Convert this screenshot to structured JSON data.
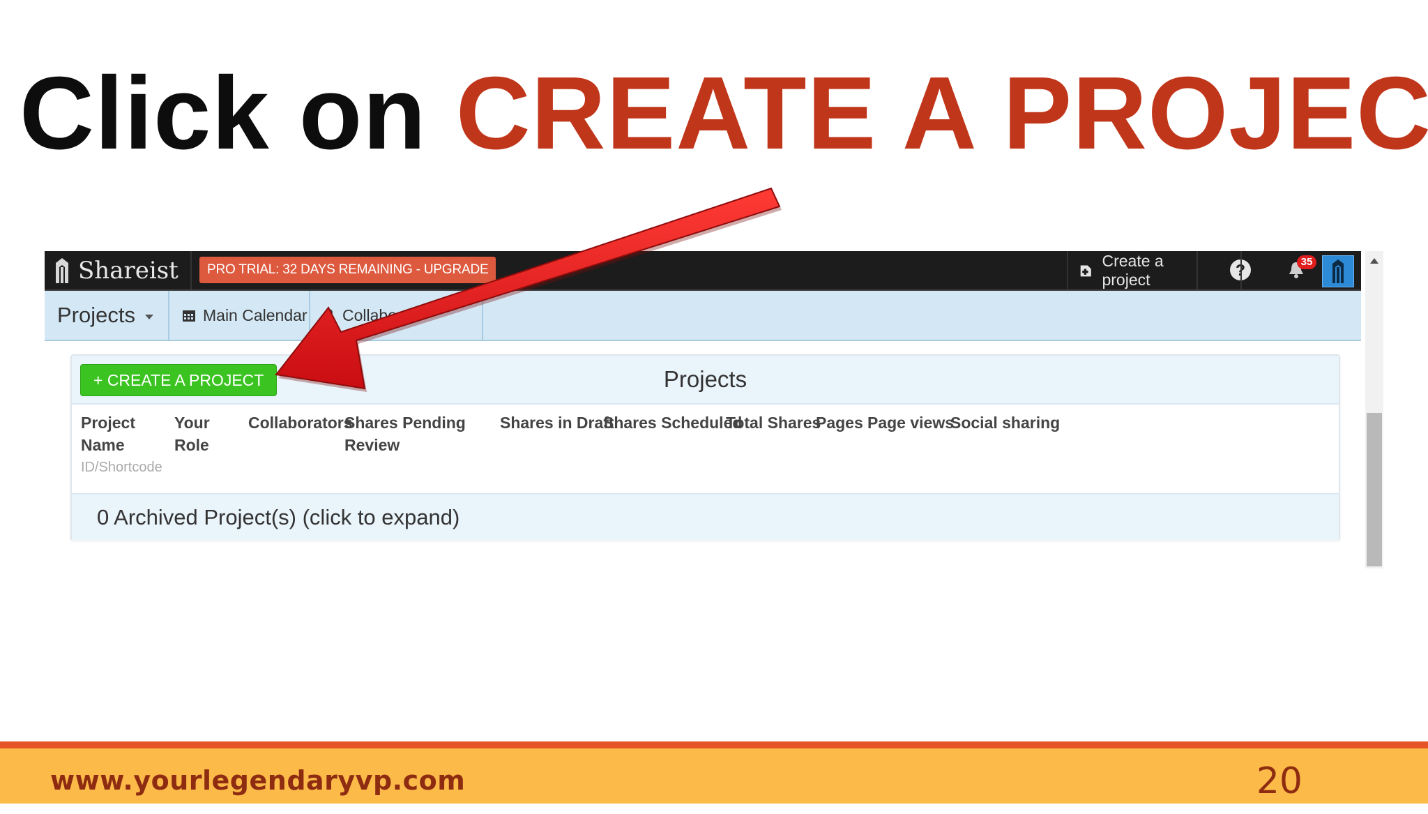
{
  "headline": {
    "prefix": "Click on",
    "highlight": "CREATE A PROJECT"
  },
  "colors": {
    "highlight": "#c0361a",
    "arrow": "#e3141a",
    "green_button": "#3bc321",
    "trial_badge": "#dd5a3f",
    "footer_bar": "#fcbb49",
    "footer_line": "#e55326"
  },
  "app": {
    "logo_text": "Shareist",
    "trial_banner": "PRO TRIAL: 32 DAYS REMAINING - UPGRADE",
    "create_project_label": "Create a project",
    "help_label": "?",
    "notification_count": "35"
  },
  "subnav": {
    "projects_label": "Projects",
    "main_calendar_label": "Main Calendar",
    "collaborators_label": "Collabor"
  },
  "panel": {
    "create_button_label": "+ CREATE A PROJECT",
    "title": "Projects",
    "columns": [
      {
        "line1": "Project",
        "line2": "Name",
        "sub": "ID/Shortcode"
      },
      {
        "line1": "Your",
        "line2": "Role"
      },
      {
        "line1": "Collaborators"
      },
      {
        "line1": "Shares Pending",
        "line2": "Review"
      },
      {
        "line1": "Shares in Draft"
      },
      {
        "line1": "Shares Scheduled"
      },
      {
        "line1": "Total Shares"
      },
      {
        "line1": "Pages"
      },
      {
        "line1": "Page views"
      },
      {
        "line1": "Social sharing"
      }
    ],
    "archived_label": "0 Archived Project(s) (click to expand)"
  },
  "footer": {
    "url": "www.yourlegendaryvp.com",
    "page_number": "20"
  }
}
